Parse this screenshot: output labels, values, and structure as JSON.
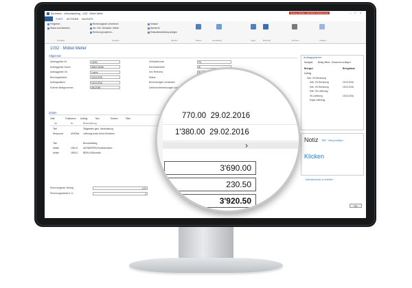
{
  "window": {
    "title": "Buchmann - Verkaufsauftrag - 1032 · Möbel Meller",
    "warning": "Testing: Schläer: CRONUS (Schweiz) AG"
  },
  "ribbon": {
    "tabs": [
      "START",
      "AKTIONEN",
      "NAVIGATE"
    ],
    "buttons": [
      "Freigeben",
      "Status zurücksetzen",
      "Rechnungsrab. berechnen",
      "Ink. Chk. Verkaufsz. fahren",
      "Rechnung kopieren...",
      "Verkauf",
      "Nachricht",
      "Einkaufsbestellung anlegen"
    ],
    "groups": [
      "Freigabe",
      "Funktion",
      "Alle Ein",
      "Planen",
      "Verwaltung",
      "Lager",
      "Buchung",
      "Drucken",
      "Anlagen"
    ]
  },
  "page": {
    "title": "1032 · Möbel Meller",
    "section_general": "Allgemein",
    "section_lines": "Zeilen"
  },
  "general": {
    "fields_left": [
      {
        "label": "Auftraggeber Nr.",
        "value": "10000"
      },
      {
        "label": "Auftraggeber Name",
        "value": "Möbel Meller"
      },
      {
        "label": "Auftraggeber Ort",
        "value": "Luzern"
      },
      {
        "label": "Buchungsdatum",
        "value": "15.03.2016"
      },
      {
        "label": "Auftragsdatum",
        "value": "15.03.2016"
      },
      {
        "label": "Externe Belegnummer",
        "value": "AB12456"
      }
    ],
    "fields_right": [
      {
        "label": "Verkäufercode",
        "value": "PS"
      },
      {
        "label": "Sachbearbeiter",
        "value": "BI"
      },
      {
        "label": "Ihre Referenz",
        "value": "Roger Müller"
      },
      {
        "label": "Status",
        "value": "Freigegeben"
      },
      {
        "label": "Bemerkungen vorhanden",
        "value": "Nein"
      },
      {
        "label": "Debitorenbemerkungen vorhanden",
        "value": ""
      }
    ]
  },
  "lines": {
    "toolbar": [
      "Zeile",
      "Funktionen",
      "Auftrag",
      "Neu",
      "Suchen",
      "Filter"
    ],
    "headers": [
      "Art",
      "Nr.",
      "Beschreibung",
      "Menge",
      "Einh"
    ],
    "rows": [
      {
        "type": "Titel",
        "no": "",
        "desc": "Teilgeleiten gem. Vereinbarung"
      },
      {
        "type": "Ressource",
        "no": "UNIONA",
        "desc": "Lieferung durch Umzü Schreiner"
      },
      {
        "type": "",
        "no": "",
        "desc": ""
      },
      {
        "type": "Titel",
        "no": "",
        "desc": "Büromobiliäng"
      },
      {
        "type": "Artikel",
        "no": "1920-S",
        "desc": "ANTWERPEN Konferenztisch"
      },
      {
        "type": "Artikel",
        "no": "1906-S",
        "desc": "BERLIN Bürostuhl"
      }
    ]
  },
  "totals": [
    {
      "label": "Rechnungsrab.-Betrag",
      "value": "0.00"
    },
    {
      "label": "Rechnungsrabatt in %",
      "value": "0"
    }
  ],
  "factbox": {
    "title": "Auftragsplanner",
    "toolbar": [
      "Navigate",
      "Beleg öffnen",
      "Dokument verlegen"
    ],
    "headers": [
      "Belegart",
      "Belegdatum"
    ],
    "items": [
      {
        "text": "Auftrag",
        "date": ""
      },
      {
        "text": "Geb. VK-Rechnung",
        "date": ""
      },
      {
        "text": "Geb. VK-Rechnung",
        "date": "15.03.2016"
      },
      {
        "text": "Geb. VK-Rechnung",
        "date": "15.03.2016"
      },
      {
        "text": "Geb. VK-Lieferung",
        "date": ""
      },
      {
        "text": "VK-Lieferung",
        "date": "15.03.2016"
      },
      {
        "text": "Kopie Lieferung",
        "date": ""
      }
    ],
    "notes_title": "Notiz",
    "notes_link": "BRP - Beleg einfügen",
    "notes_click": "Klicken",
    "extra": "Datenanschluss zu erstellen."
  },
  "ok_button": "OK",
  "magnifier": {
    "rows": [
      {
        "amount": "770.00",
        "date": "29.02.2016"
      },
      {
        "amount": "1'380.00",
        "date": "29.02.2016"
      }
    ],
    "totals": [
      "3'690.00",
      "230.50",
      "3'920.50"
    ],
    "arrow": "›"
  }
}
